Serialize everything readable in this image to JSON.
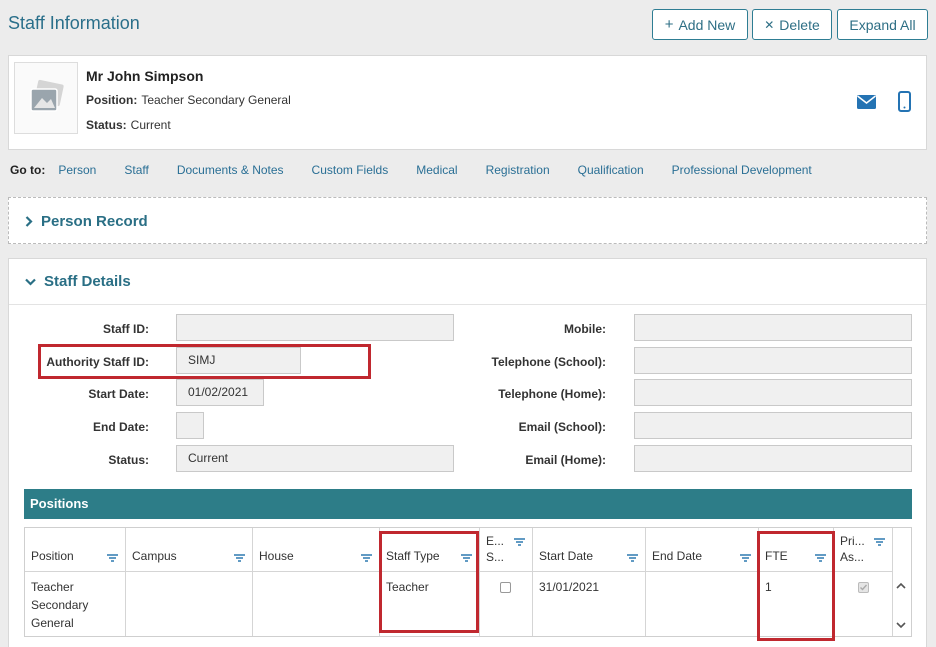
{
  "header": {
    "title": "Staff Information",
    "add_label": "Add New",
    "delete_label": "Delete",
    "expand_label": "Expand All"
  },
  "person": {
    "name": "Mr John Simpson",
    "position_label": "Position:",
    "position_value": "Teacher Secondary General",
    "status_label": "Status:",
    "status_value": "Current"
  },
  "goto": {
    "label": "Go to:",
    "links": [
      "Person",
      "Staff",
      "Documents & Notes",
      "Custom Fields",
      "Medical",
      "Registration",
      "Qualification",
      "Professional Development"
    ]
  },
  "sections": {
    "person_record": "Person Record",
    "staff_details": "Staff Details"
  },
  "staff_fields": {
    "staff_id_label": "Staff ID:",
    "staff_id_value": "",
    "authority_id_label": "Authority Staff ID:",
    "authority_id_value": "SIMJ",
    "start_date_label": "Start Date:",
    "start_date_value": "01/02/2021",
    "end_date_label": "End Date:",
    "end_date_value": "",
    "status_label": "Status:",
    "status_value": "Current",
    "mobile_label": "Mobile:",
    "tel_school_label": "Telephone (School):",
    "tel_home_label": "Telephone (Home):",
    "email_school_label": "Email (School):",
    "email_home_label": "Email (Home):"
  },
  "positions": {
    "title": "Positions",
    "columns": [
      "Position",
      "Campus",
      "House",
      "Staff Type",
      "E... S...",
      "Start Date",
      "End Date",
      "FTE",
      "Pri... As..."
    ],
    "row": {
      "position": "Teacher Secondary General",
      "campus": "",
      "house": "",
      "staff_type": "Teacher",
      "start_date": "31/01/2021",
      "end_date": "",
      "fte": "1"
    }
  },
  "colors": {
    "accent": "#2a6f85",
    "positions_bar": "#2d7d88",
    "highlight": "#c0282f"
  }
}
